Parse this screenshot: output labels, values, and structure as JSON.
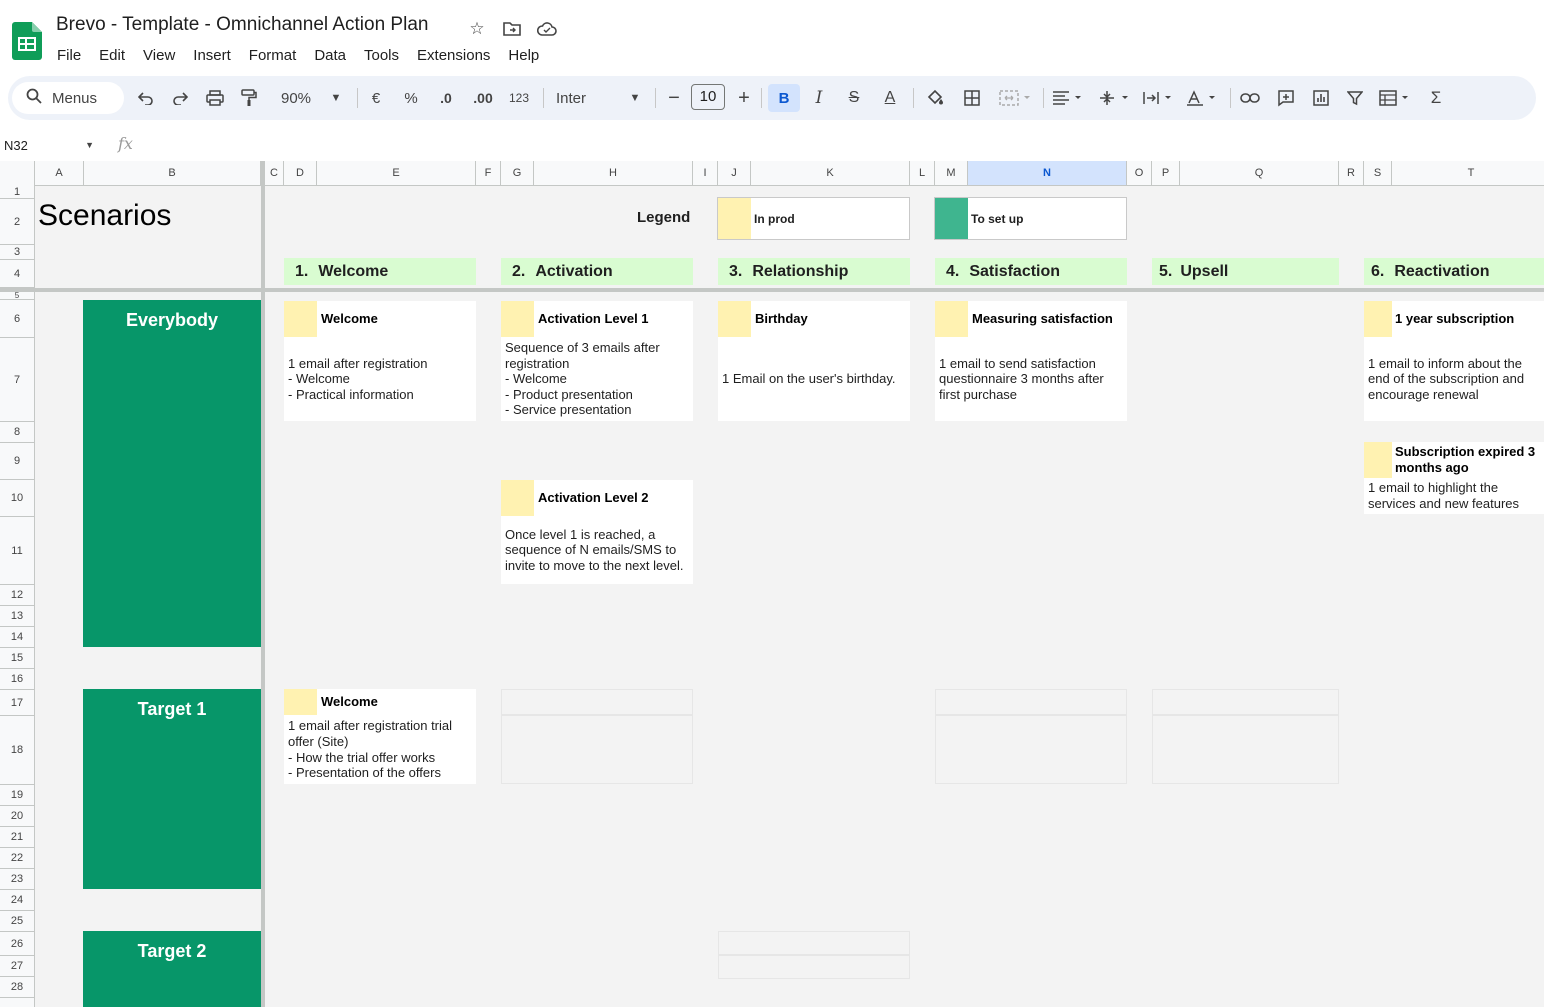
{
  "window": {
    "title": "Brevo - Template - Omnichannel Action Plan",
    "menus": [
      "File",
      "Edit",
      "View",
      "Insert",
      "Format",
      "Data",
      "Tools",
      "Extensions",
      "Help"
    ]
  },
  "toolbar": {
    "search_label": "Menus",
    "zoom": "90%",
    "currency": "€",
    "percent": "%",
    "decrease_decimal": ".0",
    "increase_decimal": ".00",
    "number_format": "123",
    "font": "Inter",
    "font_size": "10",
    "bold": "B",
    "italic": "I",
    "strikethrough": "S",
    "text_color": "A"
  },
  "formula_bar": {
    "cell_ref": "N32",
    "fx": "fx"
  },
  "grid": {
    "selected_column": "N",
    "columns": [
      "A",
      "B",
      "C",
      "D",
      "E",
      "F",
      "G",
      "H",
      "I",
      "J",
      "K",
      "L",
      "M",
      "N",
      "O",
      "P",
      "Q",
      "R",
      "S",
      "T"
    ],
    "rows": [
      "1",
      "2",
      "3",
      "4",
      "5",
      "6",
      "7",
      "8",
      "9",
      "10",
      "11",
      "12",
      "13",
      "14",
      "15",
      "16",
      "17",
      "18",
      "19",
      "20",
      "21",
      "22",
      "23",
      "24",
      "25",
      "26",
      "27",
      "28"
    ]
  },
  "sheet": {
    "title": "Scenarios",
    "legend": {
      "label": "Legend",
      "items": [
        {
          "label": "In prod",
          "color": "#fff2b1"
        },
        {
          "label": "To set up",
          "color": "#3fb58f"
        }
      ]
    },
    "stages": [
      {
        "num": "1.",
        "name": "Welcome"
      },
      {
        "num": "2.",
        "name": "Activation"
      },
      {
        "num": "3.",
        "name": "Relationship"
      },
      {
        "num": "4.",
        "name": "Satisfaction"
      },
      {
        "num": "5.",
        "name": "Upsell"
      },
      {
        "num": "6.",
        "name": "Reactivation"
      }
    ],
    "segments": [
      "Everybody",
      "Target 1",
      "Target 2"
    ],
    "cards": {
      "welcome": {
        "title": "Welcome",
        "body": "1 email after registration\n - Welcome\n - Practical information"
      },
      "activation1": {
        "title": "Activation Level 1",
        "body": "Sequence of 3 emails after registration\n - Welcome\n - Product presentation\n - Service presentation"
      },
      "birthday": {
        "title": "Birthday",
        "body": "1 Email on the user's birthday."
      },
      "satisfaction": {
        "title": "Measuring satisfaction",
        "body": "1 email to send satisfaction questionnaire 3 months after first purchase"
      },
      "subscription": {
        "title": "1 year subscription",
        "body": "1 email to inform about the end of the subscription and encourage renewal"
      },
      "expired": {
        "title": "Subscription expired 3 months ago",
        "body": "1 email to highlight the services and new features"
      },
      "activation2": {
        "title": "Activation Level 2",
        "body": "Once level 1 is reached, a sequence of N emails/SMS to invite to move to the next level."
      },
      "welcome_trial": {
        "title": "Welcome",
        "body": "1 email after registration trial offer (Site)\n - How the trial offer works\n - Presentation of the offers"
      }
    }
  },
  "colors": {
    "segment_green": "#079669",
    "stage_green": "#d9fcd1",
    "in_prod_yellow": "#fff2b1",
    "to_set_up_green": "#3fb58f"
  }
}
